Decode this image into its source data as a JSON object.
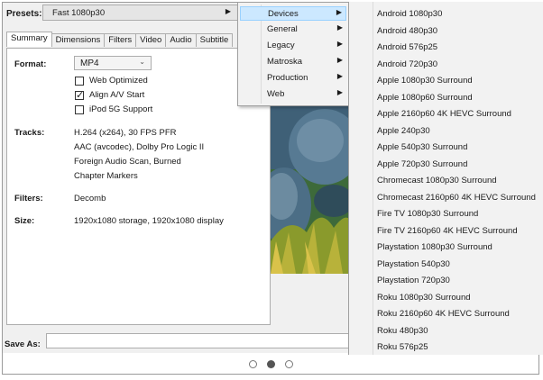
{
  "presets": {
    "label": "Presets:",
    "selected": "Fast 1080p30"
  },
  "tabs": [
    "Summary",
    "Dimensions",
    "Filters",
    "Video",
    "Audio",
    "Subtitle"
  ],
  "summary": {
    "format_label": "Format:",
    "format_value": "MP4",
    "options": [
      {
        "label": "Web Optimized",
        "checked": false
      },
      {
        "label": "Align A/V Start",
        "checked": true
      },
      {
        "label": "iPod 5G Support",
        "checked": false
      }
    ],
    "tracks_label": "Tracks:",
    "tracks": [
      "H.264 (x264), 30 FPS PFR",
      "AAC (avcodec), Dolby Pro Logic II",
      "Foreign Audio Scan, Burned",
      "Chapter Markers"
    ],
    "filters_label": "Filters:",
    "filters_value": "Decomb",
    "size_label": "Size:",
    "size_value": "1920x1080 storage, 1920x1080 display"
  },
  "save_as": {
    "label": "Save As:",
    "value": ""
  },
  "category_menu": [
    "Devices",
    "General",
    "Legacy",
    "Matroska",
    "Production",
    "Web"
  ],
  "devices_menu": [
    "Android 1080p30",
    "Android 480p30",
    "Android 576p25",
    "Android 720p30",
    "Apple 1080p30 Surround",
    "Apple 1080p60 Surround",
    "Apple 2160p60 4K HEVC Surround",
    "Apple 240p30",
    "Apple 540p30 Surround",
    "Apple 720p30 Surround",
    "Chromecast 1080p30 Surround",
    "Chromecast 2160p60 4K HEVC Surround",
    "Fire TV 1080p30 Surround",
    "Fire TV 2160p60 4K HEVC Surround",
    "Playstation 1080p30 Surround",
    "Playstation 540p30",
    "Playstation 720p30",
    "Roku 1080p30 Surround",
    "Roku 2160p60 4K HEVC Surround",
    "Roku 480p30",
    "Roku 576p25"
  ],
  "pager": {
    "count": 3,
    "active": 2
  },
  "colors": {
    "highlight": "#cce8ff",
    "menu_bg": "#f2f2f2",
    "dot_active": "#555555"
  }
}
